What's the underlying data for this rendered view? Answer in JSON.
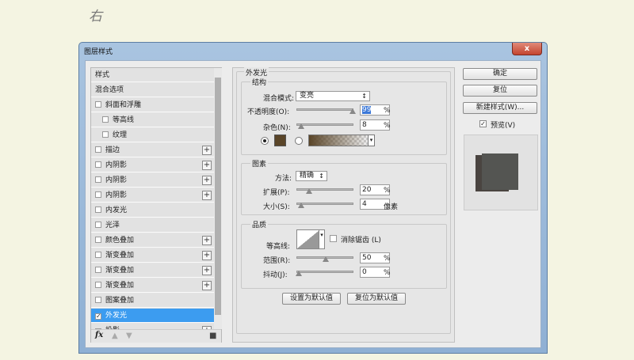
{
  "caption": "右",
  "dialog": {
    "title": "图层样式",
    "close": "x"
  },
  "list": {
    "items": [
      {
        "label": "样式",
        "checkbox": false,
        "plus": false
      },
      {
        "label": "混合选项",
        "checkbox": false,
        "plus": false
      },
      {
        "label": "斜面和浮雕",
        "checkbox": true,
        "plus": false
      },
      {
        "label": "等高线",
        "checkbox": true,
        "plus": false,
        "indent": true
      },
      {
        "label": "纹理",
        "checkbox": true,
        "plus": false,
        "indent": true
      },
      {
        "label": "描边",
        "checkbox": true,
        "plus": true
      },
      {
        "label": "内阴影",
        "checkbox": true,
        "plus": true
      },
      {
        "label": "内阴影",
        "checkbox": true,
        "plus": true
      },
      {
        "label": "内阴影",
        "checkbox": true,
        "plus": true
      },
      {
        "label": "内发光",
        "checkbox": true,
        "plus": false
      },
      {
        "label": "光泽",
        "checkbox": true,
        "plus": false
      },
      {
        "label": "颜色叠加",
        "checkbox": true,
        "plus": true
      },
      {
        "label": "渐变叠加",
        "checkbox": true,
        "plus": true
      },
      {
        "label": "渐变叠加",
        "checkbox": true,
        "plus": true
      },
      {
        "label": "渐变叠加",
        "checkbox": true,
        "plus": true
      },
      {
        "label": "图案叠加",
        "checkbox": true,
        "plus": false
      },
      {
        "label": "外发光",
        "checkbox": true,
        "checked": true,
        "selected": true,
        "plus": false
      },
      {
        "label": "投影",
        "checkbox": true,
        "checked": true,
        "plus": true
      }
    ],
    "fx": "fx"
  },
  "outer_glow": {
    "title": "外发光",
    "structure": {
      "title": "结构",
      "blend_label": "混合模式:",
      "blend_value": "变亮",
      "opacity_label": "不透明度(O):",
      "opacity": "99",
      "noise_label": "杂色(N):",
      "noise": "8",
      "unit": "%",
      "glow_color": "#5a4528"
    },
    "elements": {
      "title": "图素",
      "technique_label": "方法:",
      "technique": "精确",
      "spread_label": "扩展(P):",
      "spread": "20",
      "size_label": "大小(S):",
      "size": "4",
      "size_unit": "像素"
    },
    "quality": {
      "title": "品质",
      "contour_label": "等高线:",
      "antialias_label": "消除锯齿 (L)",
      "range_label": "范围(R):",
      "range": "50",
      "jitter_label": "抖动(J):",
      "jitter": "0"
    },
    "make_default": "设置为默认值",
    "reset_default": "复位为默认值"
  },
  "buttons": {
    "ok": "确定",
    "reset": "复位",
    "new_style": "新建样式(W)...",
    "preview": "预览(V)"
  }
}
